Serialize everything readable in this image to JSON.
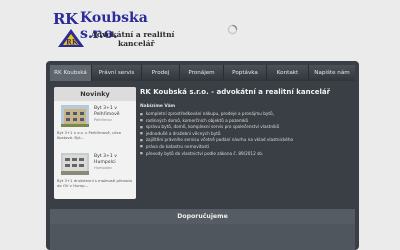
{
  "header": {
    "logo_rk": "RK",
    "logo_name": "Koubska s.r.o.",
    "logo_line1": "Advokátní a realitní",
    "logo_line2": "kancelář"
  },
  "nav": {
    "items": [
      {
        "label": "RK Koubská",
        "active": true
      },
      {
        "label": "Právní servis",
        "active": false
      },
      {
        "label": "Prodej",
        "active": false
      },
      {
        "label": "Pronájem",
        "active": false
      },
      {
        "label": "Poptávka",
        "active": false
      },
      {
        "label": "Kontakt",
        "active": false
      },
      {
        "label": "Napište nám",
        "active": false
      }
    ]
  },
  "sidebar": {
    "title": "Novinky",
    "news": [
      {
        "title": "Byt 3+1 v Pelhřimově",
        "sub": "Pelhřimov",
        "text": "Byt 3+1 v o.v. v Pelhřimově, ulice Kostová. Byt..."
      },
      {
        "title": "Byt 3+1 v Humpolci",
        "sub": "Humpolec",
        "text": "Byt 3+1 družstevní s možností převodu do OV v Hump..."
      }
    ]
  },
  "main": {
    "title": "RK Koubská s.r.o.   -   advokátní a realitní kancelář",
    "subtitle": "Nabízíme Vám",
    "list": [
      "kompletní zprostředkování nákupu, prodeje a pronájmu bytů,",
      "rodinných domů, komerčních objektů a pozemků",
      "správu bytů, domů, komplexní servis pro společenství vlastníků",
      "jednodušé a dražební věcných bytů",
      "zajištění právního servisu včetně podání návrhu na vklad vlastnického",
      "práva do katastru nemovitostí",
      "převody bytů do vlastnictví podle zákona č. 89/2012 sb."
    ]
  },
  "recommend": {
    "title": "Doporučujeme"
  }
}
